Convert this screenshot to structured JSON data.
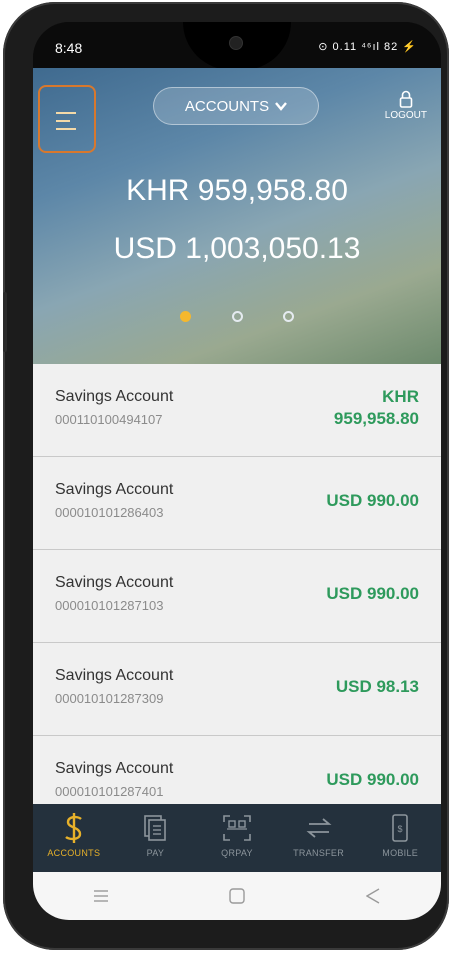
{
  "status_bar": {
    "time": "8:48",
    "indicators": "⊙ 0.11 ⁴⁶ıl 82 ⚡"
  },
  "header": {
    "menu_icon": "hamburger-icon",
    "accounts_label": "ACCOUNTS",
    "logout_label": "LOGOUT"
  },
  "balances": {
    "khr": "KHR 959,958.80",
    "usd": "USD 1,003,050.13"
  },
  "carousel": {
    "count": 3,
    "active_index": 0
  },
  "accounts": [
    {
      "name": "Savings Account",
      "number": "000110100494107",
      "currency": "KHR",
      "amount": "959,958.80"
    },
    {
      "name": "Savings Account",
      "number": "000010101286403",
      "amount_full": "USD 990.00"
    },
    {
      "name": "Savings Account",
      "number": "000010101287103",
      "amount_full": "USD 990.00"
    },
    {
      "name": "Savings Account",
      "number": "000010101287309",
      "amount_full": "USD 98.13"
    },
    {
      "name": "Savings Account",
      "number": "000010101287401",
      "amount_full": "USD 990.00"
    }
  ],
  "tabs": [
    {
      "label": "ACCOUNTS",
      "icon": "dollar-icon",
      "active": true
    },
    {
      "label": "PAY",
      "icon": "bill-icon"
    },
    {
      "label": "QRPAY",
      "icon": "qr-icon"
    },
    {
      "label": "TRANSFER",
      "icon": "transfer-icon"
    },
    {
      "label": "MOBILE",
      "icon": "mobile-icon"
    }
  ],
  "system_nav": {
    "menu": "menu-icon",
    "home": "home-icon",
    "back": "back-icon"
  },
  "colors": {
    "accent": "#f5b82e",
    "amount_green": "#2e9a5c",
    "tabbar_bg": "#24313d",
    "highlight_border": "#d8782d"
  }
}
